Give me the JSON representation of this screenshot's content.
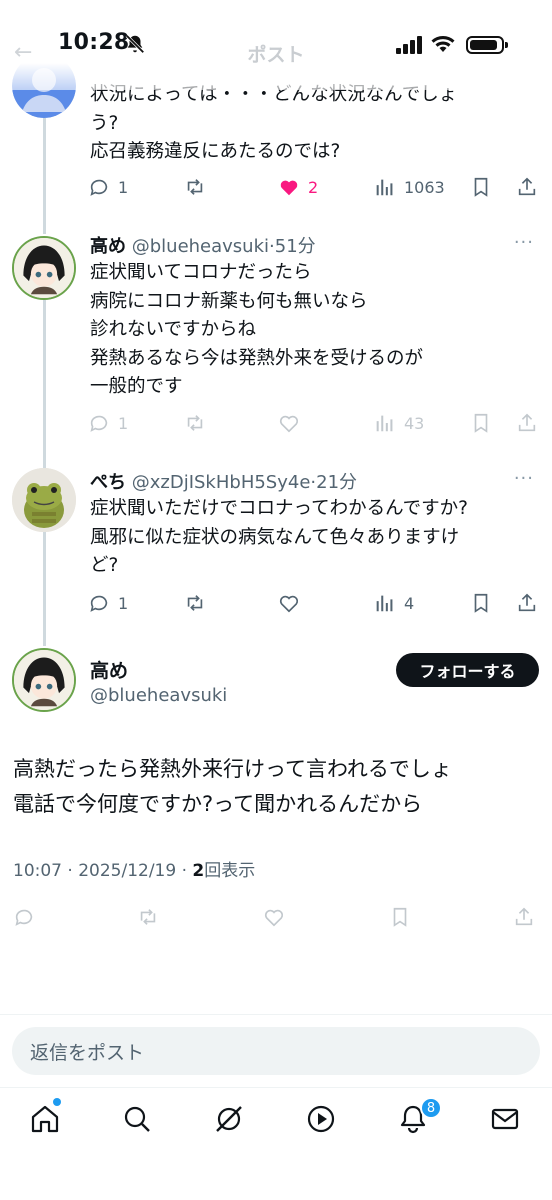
{
  "status_bar": {
    "time": "10:28"
  },
  "header": {
    "title": "ポスト",
    "back": "←"
  },
  "tweets": [
    {
      "lines": [
        "状況によっては・・・どんな状況なんでしょ",
        "う?",
        "応召義務違反にあたるのでは?"
      ],
      "replies": "1",
      "likes": "2",
      "views": "1063"
    },
    {
      "name": "高め",
      "handle": "@blueheavsuki",
      "time": "·51分",
      "lines": [
        "症状聞いてコロナだったら",
        "病院にコロナ新薬も何も無いなら",
        "診れないですからね",
        "発熱あるなら今は発熱外来を受けるのが",
        "一般的です"
      ],
      "replies": "1",
      "views": "43"
    },
    {
      "name": "ぺち",
      "handle": "@xzDjISkHbH5Sy4e",
      "time": "·21分",
      "lines": [
        "症状聞いただけでコロナってわかるんですか?",
        "風邪に似た症状の病気なんて色々ありますけ",
        "ど?"
      ],
      "replies": "1",
      "views": "4"
    }
  ],
  "main_post": {
    "name": "高め",
    "handle": "@blueheavsuki",
    "follow_label": "フォローする",
    "lines": [
      "高熱だったら発熱外来行けって言われるでしょ",
      "電話で今何度ですか?って聞かれるんだから"
    ],
    "timestamp": "10:07 · 2025/12/19 · ",
    "view_count": "2",
    "view_label": "回表示"
  },
  "reply_placeholder": "返信をポスト",
  "tabbar": {
    "notification_badge": "8"
  },
  "more_label": "···",
  "colors": {
    "accent": "#1d9bf0",
    "like": "#f91880",
    "text": "#0f1419",
    "secondary": "#536471"
  }
}
